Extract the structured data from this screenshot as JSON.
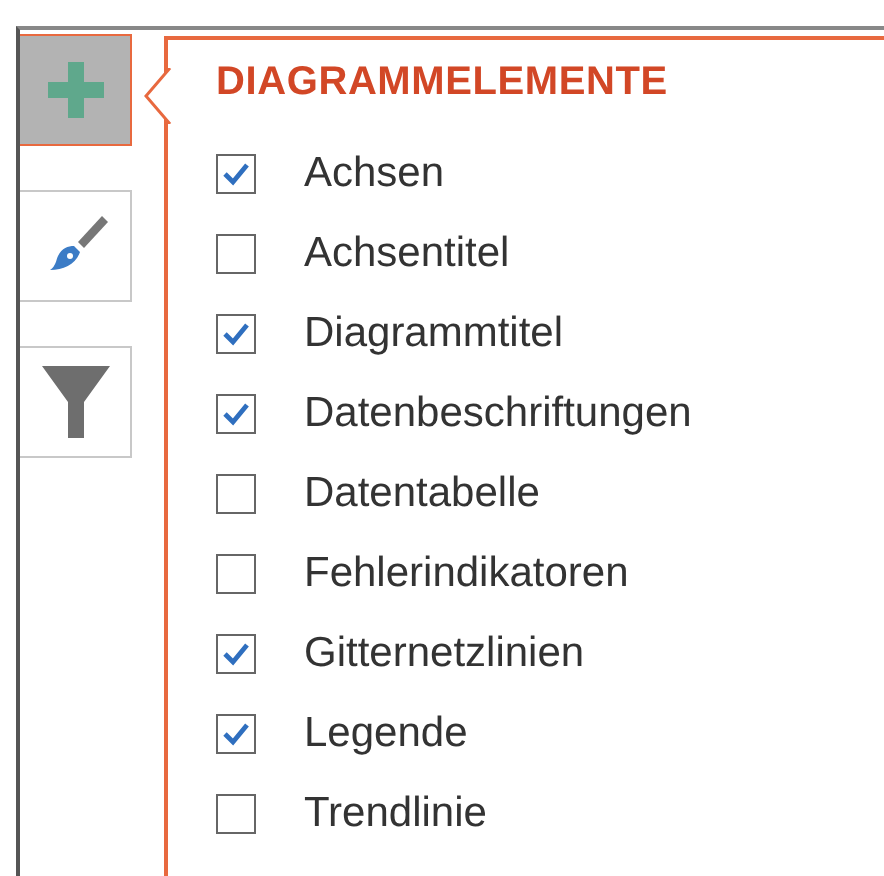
{
  "side_buttons": [
    {
      "kind": "plus",
      "selected": true
    },
    {
      "kind": "brush",
      "selected": false
    },
    {
      "kind": "filter",
      "selected": false
    }
  ],
  "panel": {
    "title": "DIAGRAMMELEMENTE",
    "items": [
      {
        "label": "Achsen",
        "checked": true
      },
      {
        "label": "Achsentitel",
        "checked": false
      },
      {
        "label": "Diagrammtitel",
        "checked": true
      },
      {
        "label": "Datenbeschriftungen",
        "checked": true
      },
      {
        "label": "Datentabelle",
        "checked": false
      },
      {
        "label": "Fehlerindikatoren",
        "checked": false
      },
      {
        "label": "Gitternetzlinien",
        "checked": true
      },
      {
        "label": "Legende",
        "checked": true
      },
      {
        "label": "Trendlinie",
        "checked": false
      }
    ]
  }
}
